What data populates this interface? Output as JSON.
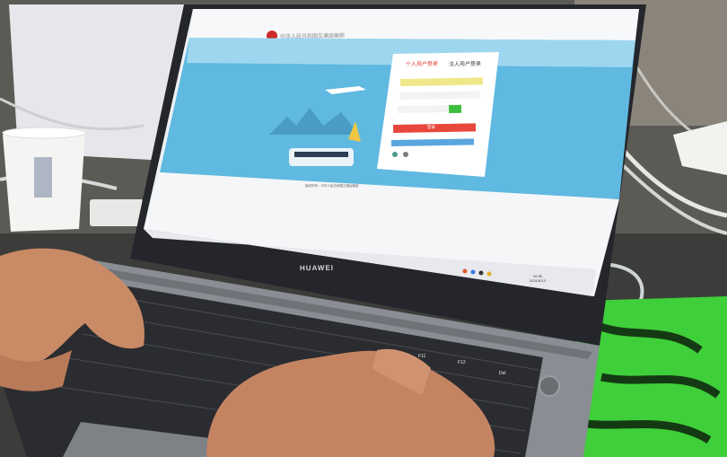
{
  "laptop": {
    "brand": "HUAWEI"
  },
  "screen": {
    "site_title": "中华人民共和国交通运输部",
    "login_tabs": [
      "个人用户登录",
      "法人用户登录"
    ],
    "login_button": "登录",
    "footer": "版权所有：中华人民共和国交通运输部",
    "taskbar_clock": [
      "10:35",
      "2021/5/13"
    ]
  },
  "keys": {
    "del": "Del",
    "f11": "F11",
    "f12": "F12"
  },
  "colors": {
    "screen_sky": "#5fb9e0",
    "login_tab_active": "#e0443a",
    "login_button": "#e8473c",
    "mousepad_green": "#3fcf3a",
    "laptop_body": "#8a8d93"
  }
}
